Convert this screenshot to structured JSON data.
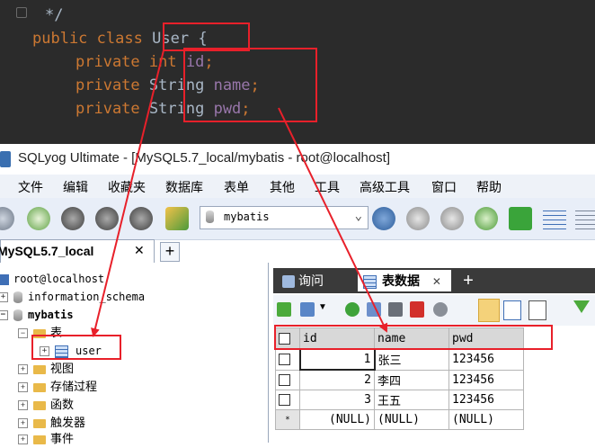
{
  "code": {
    "comment_end": "*/",
    "class_decl": {
      "kw1": "public",
      "kw2": "class",
      "name": "User",
      "brace": "{"
    },
    "fields": [
      {
        "mod": "private",
        "type": "int",
        "name": "id",
        "semi": ";"
      },
      {
        "mod": "private",
        "type": "String",
        "name": "name",
        "semi": ";"
      },
      {
        "mod": "private",
        "type": "String",
        "name": "pwd",
        "semi": ";"
      }
    ]
  },
  "window": {
    "title": "SQLyog Ultimate - [MySQL5.7_local/mybatis - root@localhost]"
  },
  "menu": [
    "文件",
    "编辑",
    "收藏夹",
    "数据库",
    "表单",
    "其他",
    "工具",
    "高级工具",
    "窗口",
    "帮助"
  ],
  "toolbar": {
    "db_select": "mybatis"
  },
  "connection_tab": {
    "label": "MySQL5.7_local",
    "plus": "+"
  },
  "tree": {
    "root": "root@localhost",
    "db_info": "information_schema",
    "db_mybatis": "mybatis",
    "folder_tables": "表",
    "table_user": "user",
    "folder_views": "视图",
    "folder_procs": "存储过程",
    "folder_funcs": "函数",
    "folder_triggers": "触发器",
    "folder_events": "事件"
  },
  "result_tabs": [
    {
      "label": "询问",
      "close": ""
    },
    {
      "label": "表数据",
      "close": "✕"
    }
  ],
  "result_plus": "+",
  "table_data": {
    "columns": [
      "id",
      "name",
      "pwd"
    ],
    "rows": [
      {
        "id": "1",
        "name": "张三",
        "pwd": "123456"
      },
      {
        "id": "2",
        "name": "李四",
        "pwd": "123456"
      },
      {
        "id": "3",
        "name": "王五",
        "pwd": "123456"
      },
      {
        "id": "(NULL)",
        "name": "(NULL)",
        "pwd": "(NULL)",
        "marker": "*"
      }
    ]
  },
  "colors": {
    "annotation": "#e8202a",
    "code_bg": "#2b2b2b",
    "keyword": "#cc7832",
    "field": "#9876aa"
  }
}
